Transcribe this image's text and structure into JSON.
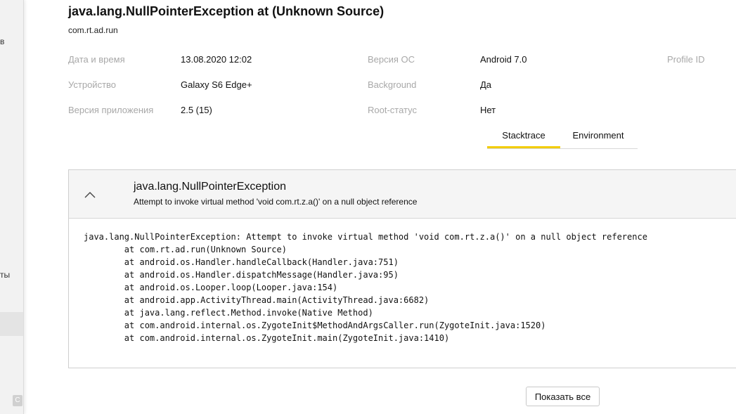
{
  "sidebar": {
    "fragment_top": "в",
    "fragment_mid": "ты",
    "corner_badge": "С"
  },
  "header": {
    "title": "java.lang.NullPointerException at (Unknown Source)",
    "package": "com.rt.ad.run"
  },
  "details": {
    "datetime": {
      "label": "Дата и время",
      "value": "13.08.2020 12:02"
    },
    "device": {
      "label": "Устройство",
      "value": "Galaxy S6 Edge+"
    },
    "app_version": {
      "label": "Версия приложения",
      "value": "2.5 (15)"
    },
    "os_version": {
      "label": "Версия ОС",
      "value": "Android 7.0"
    },
    "background": {
      "label": "Background",
      "value": "Да"
    },
    "root_status": {
      "label": "Root-статус",
      "value": "Нет"
    },
    "profile_id": {
      "label": "Profile ID"
    }
  },
  "tabs": [
    {
      "label": "Stacktrace",
      "active": true
    },
    {
      "label": "Environment",
      "active": false
    }
  ],
  "exception": {
    "name": "java.lang.NullPointerException",
    "message": "Attempt to invoke virtual method 'void com.rt.z.a()' on a null object reference",
    "stacktrace": [
      "java.lang.NullPointerException: Attempt to invoke virtual method 'void com.rt.z.a()' on a null object reference",
      "        at com.rt.ad.run(Unknown Source)",
      "        at android.os.Handler.handleCallback(Handler.java:751)",
      "        at android.os.Handler.dispatchMessage(Handler.java:95)",
      "        at android.os.Looper.loop(Looper.java:154)",
      "        at android.app.ActivityThread.main(ActivityThread.java:6682)",
      "        at java.lang.reflect.Method.invoke(Native Method)",
      "        at com.android.internal.os.ZygoteInit$MethodAndArgsCaller.run(ZygoteInit.java:1520)",
      "        at com.android.internal.os.ZygoteInit.main(ZygoteInit.java:1410)"
    ]
  },
  "actions": {
    "show_all": "Показать все"
  },
  "colors": {
    "accent": "#f2cc00",
    "label": "#a8a8a8",
    "panel_header_bg": "#f5f5f5"
  },
  "icons": {
    "collapse": "chevron-up-icon"
  }
}
